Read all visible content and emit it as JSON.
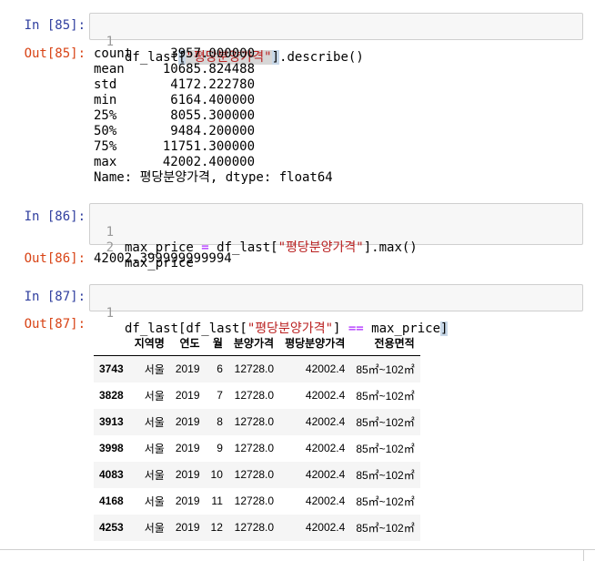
{
  "cells": [
    {
      "in_prompt": "In [85]:",
      "out_prompt": "Out[85]:",
      "code": [
        {
          "n": "1",
          "parts": [
            {
              "t": "df_last",
              "c": ""
            },
            {
              "t": "[",
              "c": "hl-br"
            },
            {
              "t": "\"평당분양가격\"",
              "c": "tok-str hl"
            },
            {
              "t": "]",
              "c": "hl-br"
            },
            {
              "t": ".describe()",
              "c": ""
            }
          ]
        }
      ],
      "output_lines": [
        "count     3957.000000",
        "mean     10685.824488",
        "std       4172.222780",
        "min       6164.400000",
        "25%       8055.300000",
        "50%       9484.200000",
        "75%      11751.300000",
        "max      42002.400000",
        "Name: 평당분양가격, dtype: float64"
      ]
    },
    {
      "in_prompt": "In [86]:",
      "out_prompt": "Out[86]:",
      "code": [
        {
          "n": "1",
          "parts": [
            {
              "t": "max_price ",
              "c": ""
            },
            {
              "t": "=",
              "c": "tok-op"
            },
            {
              "t": " df_last[",
              "c": ""
            },
            {
              "t": "\"평당분양가격\"",
              "c": "tok-str"
            },
            {
              "t": "].max()",
              "c": ""
            }
          ]
        },
        {
          "n": "2",
          "parts": [
            {
              "t": "max_price",
              "c": ""
            }
          ]
        }
      ],
      "output_lines": [
        "42002.399999999994"
      ]
    },
    {
      "in_prompt": "In [87]:",
      "out_prompt": "Out[87]:",
      "code": [
        {
          "n": "1",
          "parts": [
            {
              "t": "df_last[df_last[",
              "c": ""
            },
            {
              "t": "\"평당분양가격\"",
              "c": "tok-str"
            },
            {
              "t": "] ",
              "c": ""
            },
            {
              "t": "==",
              "c": "tok-op"
            },
            {
              "t": " max_price",
              "c": ""
            },
            {
              "t": "]",
              "c": "hl-br"
            }
          ]
        }
      ]
    }
  ],
  "dataframe": {
    "columns": [
      "",
      "지역명",
      "연도",
      "월",
      "분양가격",
      "평당분양가격",
      "전용면적"
    ],
    "rows": [
      [
        "3743",
        "서울",
        "2019",
        "6",
        "12728.0",
        "42002.4",
        "85㎡~102㎡"
      ],
      [
        "3828",
        "서울",
        "2019",
        "7",
        "12728.0",
        "42002.4",
        "85㎡~102㎡"
      ],
      [
        "3913",
        "서울",
        "2019",
        "8",
        "12728.0",
        "42002.4",
        "85㎡~102㎡"
      ],
      [
        "3998",
        "서울",
        "2019",
        "9",
        "12728.0",
        "42002.4",
        "85㎡~102㎡"
      ],
      [
        "4083",
        "서울",
        "2019",
        "10",
        "12728.0",
        "42002.4",
        "85㎡~102㎡"
      ],
      [
        "4168",
        "서울",
        "2019",
        "11",
        "12728.0",
        "42002.4",
        "85㎡~102㎡"
      ],
      [
        "4253",
        "서울",
        "2019",
        "12",
        "12728.0",
        "42002.4",
        "85㎡~102㎡"
      ]
    ]
  }
}
